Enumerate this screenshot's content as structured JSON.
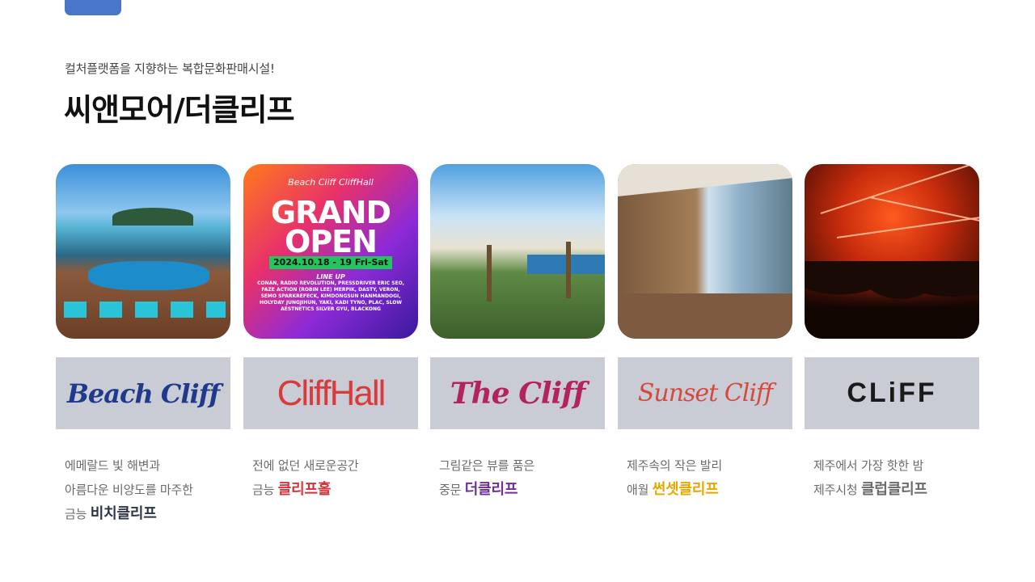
{
  "header": {
    "subtitle": "컬처플랫폼을 지향하는 복합문화판매시설!",
    "title": "씨앤모어/더클리프"
  },
  "poster": {
    "small": "Beach Cliff CliffHall",
    "big_line1": "GRAND",
    "big_line2": "OPEN",
    "date": "2024.10.18 - 19 Fri-Sat",
    "lineup_title": "LINE UP",
    "lineup": "CONAN, RADIO REVOLUTION, PRESSDRIVER ERIC SEO, FAZE ACTION (ROBIN LEE) MERPIK, DASTY, VERON, SEMO SPARKREFECK, KIMDONGSUN HANMANDOGI, HOLYDAY JUNGJIHUN, YAKI, KADI TYNO, PLAC, SLOW AESTNETICS SILVER GYU, BLACKONG"
  },
  "cards": [
    {
      "logo": "Beach Cliff",
      "logo_color": "#1f3a8a",
      "line1": "에메랄드 빛 해변과",
      "line2": "아름다운 비양도를 마주한",
      "prefix": "금능",
      "name": "비치클리프",
      "name_color": "#2d3748"
    },
    {
      "logo": "CliffHall",
      "logo_color": "#d93b3b",
      "line1": "전에 없던 새로운공간",
      "prefix": "금능",
      "name": "클리프홀",
      "name_color": "#d6333b"
    },
    {
      "logo": "The Cliff",
      "logo_color": "#b3245f",
      "line1": "그림같은 뷰를 품은",
      "prefix": "중문",
      "name": "더클리프",
      "name_color": "#6b2fa0"
    },
    {
      "logo": "Sunset Cliff",
      "logo_color": "#d44a3e",
      "line1": "제주속의 작은 발리",
      "prefix": "애월",
      "name": "썬셋클리프",
      "name_color": "#e6a700"
    },
    {
      "logo": "CLiFF",
      "logo_color": "#1a1a1a",
      "line1": "제주에서 가장 핫한 밤",
      "prefix": "제주시청",
      "name": "클럽클리프",
      "name_color": "#6b6b6b"
    }
  ]
}
